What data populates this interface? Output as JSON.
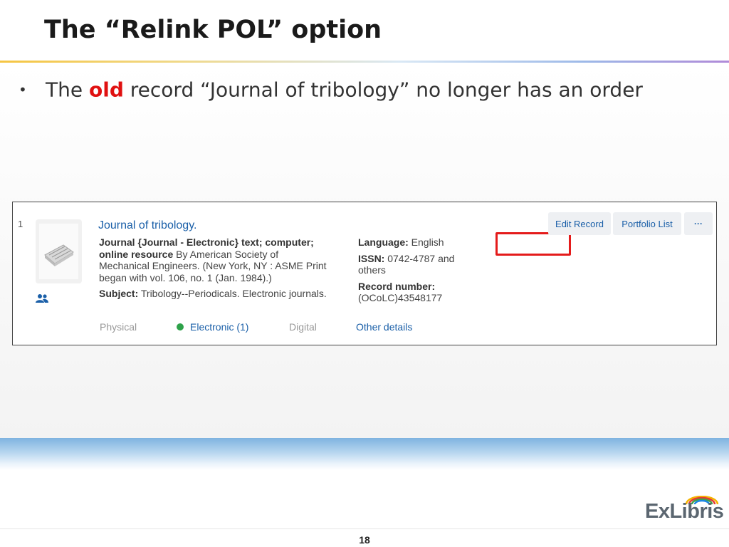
{
  "slide": {
    "title": "The “Relink POL” option",
    "page_number": "18"
  },
  "bullet": {
    "prefix": "The",
    "highlight": "old",
    "suffix": "record “Journal of tribology” no longer has an order",
    "highlight_color": "#e01010"
  },
  "record": {
    "index": "1",
    "title": "Journal of tribology.",
    "type_label": "Journal {Journal - Electronic} text; computer; online resource",
    "publisher": "By American Society of Mechanical Engineers. (New York, NY : ASME Print began with vol. 106, no. 1 (Jan. 1984).)",
    "subject_label": "Subject:",
    "subject_value": "Tribology--Periodicals. Electronic journals.",
    "language_label": "Language:",
    "language_value": "English",
    "issn_label": "ISSN:",
    "issn_value": "0742-4787 and others",
    "record_number_label": "Record number:",
    "record_number_value": "(OCoLC)43548177",
    "links": {
      "physical": "Physical",
      "electronic": "Electronic (1)",
      "digital": "Digital",
      "other_details": "Other details"
    },
    "buttons": {
      "edit_record": "Edit Record",
      "portfolio_list": "Portfolio List",
      "more": "···"
    },
    "icons": {
      "thumbnail": "journal-thumbnail-icon",
      "users": "users-icon",
      "availability": "green-dot-icon"
    }
  },
  "logo": {
    "text": "ExLibris"
  },
  "colors": {
    "link": "#1a5fa8",
    "highlight_box": "#e41b1b",
    "electronic_dot": "#2ea24a"
  }
}
